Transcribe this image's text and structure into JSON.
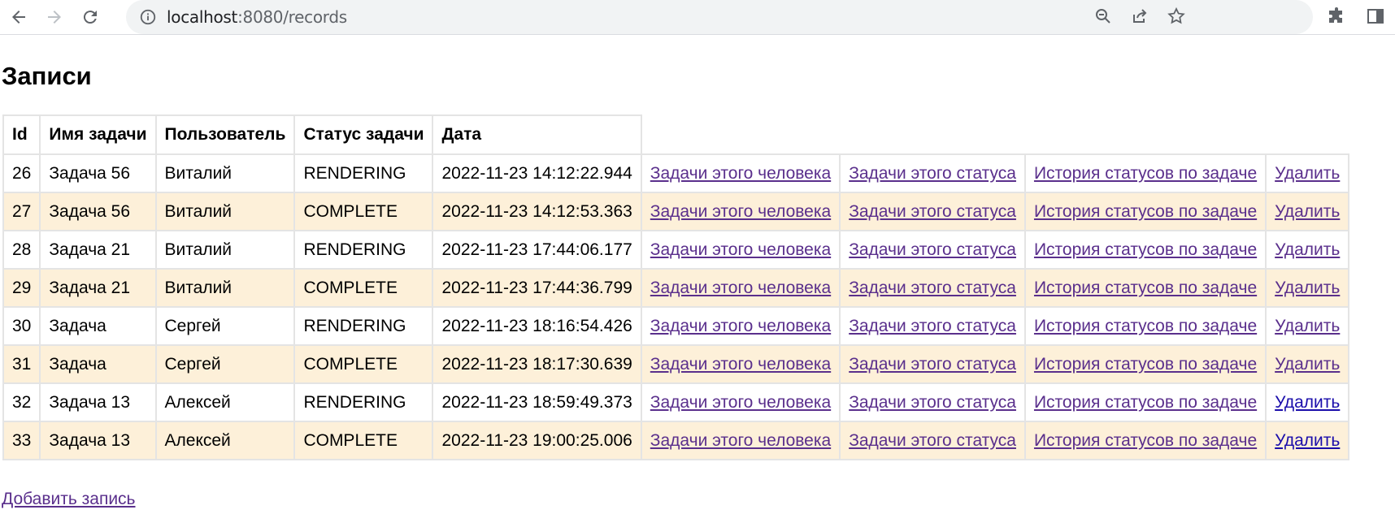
{
  "browser": {
    "url_host": "localhost",
    "url_rest": ":8080/records"
  },
  "page": {
    "title": "Записи",
    "add_link": "Добавить запись"
  },
  "table": {
    "headers": [
      "Id",
      "Имя задачи",
      "Пользователь",
      "Статус задачи",
      "Дата"
    ],
    "link_labels": {
      "by_person": "Задачи этого человека",
      "by_status": "Задачи этого статуса",
      "history": "История статусов по задаче",
      "delete": "Удалить"
    },
    "rows": [
      {
        "id": "26",
        "task": "Задача 56",
        "user": "Виталий",
        "status": "RENDERING",
        "date": "2022-11-23 14:12:22.944"
      },
      {
        "id": "27",
        "task": "Задача 56",
        "user": "Виталий",
        "status": "COMPLETE",
        "date": "2022-11-23 14:12:53.363"
      },
      {
        "id": "28",
        "task": "Задача 21",
        "user": "Виталий",
        "status": "RENDERING",
        "date": "2022-11-23 17:44:06.177"
      },
      {
        "id": "29",
        "task": "Задача 21",
        "user": "Виталий",
        "status": "COMPLETE",
        "date": "2022-11-23 17:44:36.799"
      },
      {
        "id": "30",
        "task": "Задача",
        "user": "Сергей",
        "status": "RENDERING",
        "date": "2022-11-23 18:16:54.426"
      },
      {
        "id": "31",
        "task": "Задача",
        "user": "Сергей",
        "status": "COMPLETE",
        "date": "2022-11-23 18:17:30.639"
      },
      {
        "id": "32",
        "task": "Задача 13",
        "user": "Алексей",
        "status": "RENDERING",
        "date": "2022-11-23 18:59:49.373"
      },
      {
        "id": "33",
        "task": "Задача 13",
        "user": "Алексей",
        "status": "COMPLETE",
        "date": "2022-11-23 19:00:25.006"
      }
    ]
  },
  "colors": {
    "row_alt_bg": "#fdf0d9",
    "visited_link": "#5a2f8c",
    "unvisited_link": "#1a0dab",
    "toolbar_bg": "#f1f3f4"
  }
}
